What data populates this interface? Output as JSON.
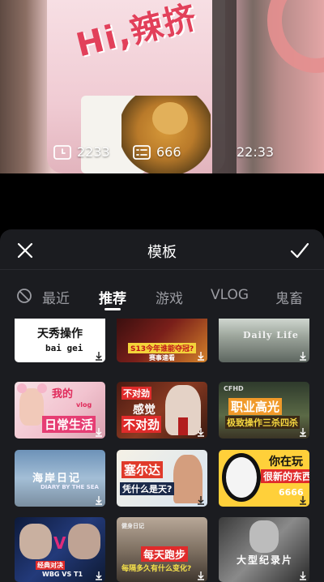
{
  "preview": {
    "brand_text": "Hi,辣挤",
    "stats": {
      "clock_value": "2233",
      "list_value": "666",
      "time": "22:33"
    }
  },
  "sheet": {
    "title": "模板",
    "tabs": [
      {
        "label": "最近",
        "active": false
      },
      {
        "label": "推荐",
        "active": true
      },
      {
        "label": "游戏",
        "active": false
      },
      {
        "label": "VLOG",
        "active": false
      },
      {
        "label": "鬼畜",
        "active": false
      }
    ],
    "thumbnails": [
      {
        "captions": [
          "天秀操作",
          "bai gei"
        ]
      },
      {
        "captions": [
          "S13今年谁能夺冠?",
          "赛事速看"
        ]
      },
      {
        "captions": [
          "Daily Life"
        ]
      },
      {
        "captions": [
          "我的",
          "vlog",
          "日常生活"
        ]
      },
      {
        "captions": [
          "不对劲",
          "感觉",
          "不对劲"
        ]
      },
      {
        "captions": [
          "CFHD",
          "职业高光",
          "极致操作三杀四杀"
        ]
      },
      {
        "captions": [
          "海岸日记",
          "DIARY BY THE SEA"
        ]
      },
      {
        "captions": [
          "塞尔达",
          "凭什么是天?"
        ]
      },
      {
        "captions": [
          "你在玩",
          "很新的东西",
          "6666"
        ]
      },
      {
        "captions": [
          "经典对决",
          "WBG VS T1"
        ]
      },
      {
        "captions": [
          "健身日记",
          "每天跑步",
          "每隔多久有什么变化?"
        ]
      },
      {
        "captions": [
          "大型纪录片"
        ]
      }
    ]
  }
}
